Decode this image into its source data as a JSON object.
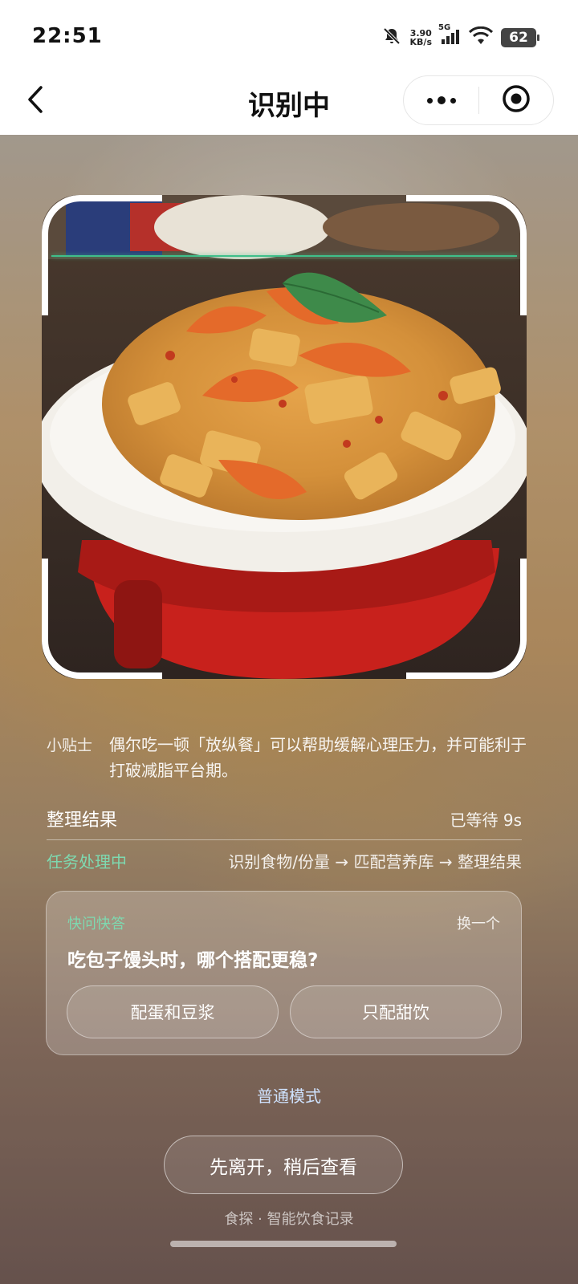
{
  "status_bar": {
    "time": "22:51",
    "net_speed_value": "3.90",
    "net_speed_unit": "KB/s",
    "network": "5G",
    "battery": "62"
  },
  "nav": {
    "title": "识别中"
  },
  "tip": {
    "label": "小贴士",
    "text": "偶尔吃一顿「放纵餐」可以帮助缓解心理压力，并可能利于打破减脂平台期。"
  },
  "result": {
    "title": "整理结果",
    "wait": "已等待 9s",
    "task_status": "任务处理中",
    "task_steps": "识别食物/份量 → 匹配营养库 → 整理结果"
  },
  "quick_qa": {
    "tag": "快问快答",
    "refresh": "换一个",
    "question": "吃包子馒头时，哪个搭配更稳?",
    "options": [
      "配蛋和豆浆",
      "只配甜饮"
    ]
  },
  "mode_link": "普通模式",
  "leave_button": "先离开，稍后查看",
  "footer": "食探 · 智能饮食记录",
  "colors": {
    "accent_green": "#7ed9b0",
    "scan_line": "#3fbf8a"
  }
}
